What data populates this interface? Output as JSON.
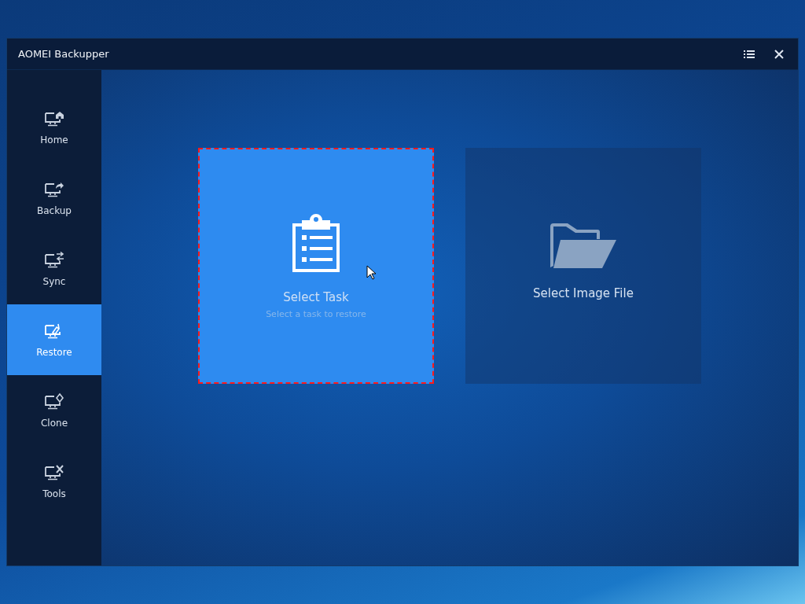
{
  "window": {
    "title": "AOMEI Backupper"
  },
  "sidebar": {
    "items": [
      {
        "label": "Home",
        "selected": false
      },
      {
        "label": "Backup",
        "selected": false
      },
      {
        "label": "Sync",
        "selected": false
      },
      {
        "label": "Restore",
        "selected": true
      },
      {
        "label": "Clone",
        "selected": false
      },
      {
        "label": "Tools",
        "selected": false
      }
    ]
  },
  "options": [
    {
      "title": "Select Task",
      "subtitle": "Select a task to restore",
      "selected": true
    },
    {
      "title": "Select Image File",
      "selected": false
    }
  ]
}
